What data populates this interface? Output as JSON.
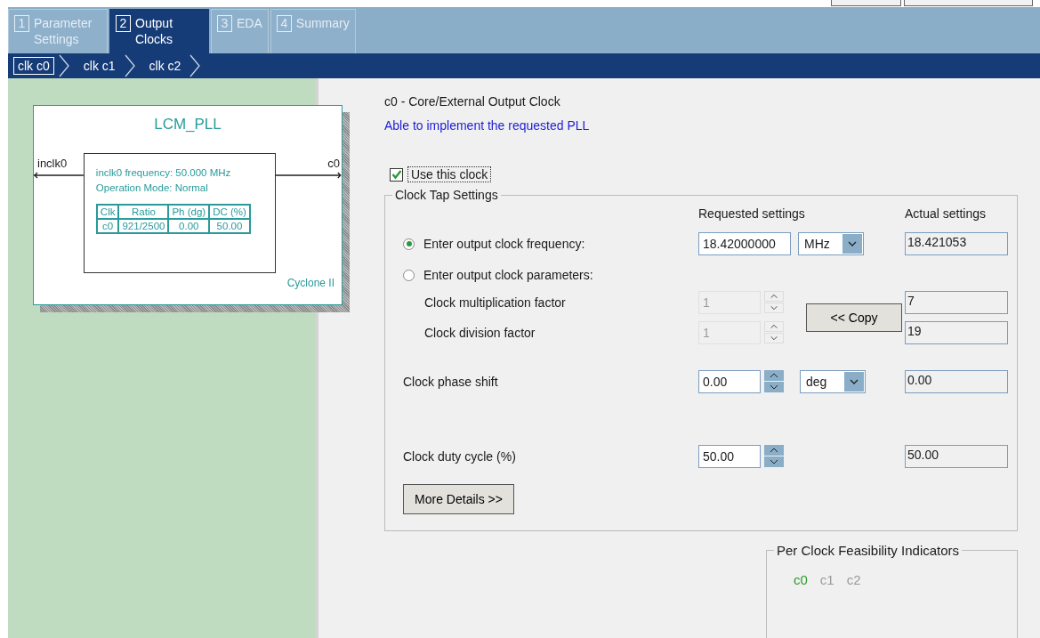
{
  "tabs": [
    {
      "number": "1",
      "label": "Parameter Settings",
      "selected": false
    },
    {
      "number": "2",
      "label": "Output Clocks",
      "selected": true
    },
    {
      "number": "3",
      "label": "EDA",
      "selected": false
    },
    {
      "number": "4",
      "label": "Summary",
      "selected": false
    }
  ],
  "clock_steps": [
    {
      "label": "clk c0",
      "selected": true
    },
    {
      "label": "clk c1",
      "selected": false
    },
    {
      "label": "clk c2",
      "selected": false
    }
  ],
  "diagram": {
    "title": "LCM_PLL",
    "input": "inclk0",
    "output": "c0",
    "info": [
      "inclk0 frequency: 50.000 MHz",
      "Operation Mode: Normal"
    ],
    "table": {
      "columns": [
        "Clk",
        "Ratio",
        "Ph (dg)",
        "DC (%)"
      ],
      "rows": [
        [
          "c0",
          "921/2500",
          "0.00",
          "50.00"
        ]
      ]
    },
    "device": "Cyclone II"
  },
  "heading": "c0 - Core/External Output Clock",
  "status": "Able to implement the requested PLL",
  "use_clock": {
    "label": "Use this clock",
    "checked": true
  },
  "clock_tap": {
    "title": "Clock Tap Settings",
    "requested_header": "Requested settings",
    "actual_header": "Actual settings",
    "rows": [
      {
        "kind": "radio",
        "label": "Enter output clock frequency:",
        "selected": true,
        "value": "18.42000000",
        "unit": "MHz",
        "actual": "18.421053"
      },
      {
        "kind": "radio",
        "label": "Enter output clock parameters:",
        "selected": false
      },
      {
        "kind": "factor",
        "label": "Clock multiplication factor",
        "value": "1",
        "disabled": true,
        "actual": "7"
      },
      {
        "kind": "factor",
        "label": "Clock division factor",
        "value": "1",
        "disabled": true,
        "actual": "19"
      },
      {
        "kind": "spin",
        "label": "Clock phase shift",
        "value": "0.00",
        "unit": "deg",
        "actual": "0.00"
      },
      {
        "kind": "spin",
        "label": "Clock duty cycle (%)",
        "value": "50.00",
        "actual": "50.00"
      }
    ],
    "copy_button": "<< Copy",
    "details_button": "More Details >>"
  },
  "feasibility": {
    "title": "Per Clock Feasibility Indicators",
    "clocks": [
      {
        "label": "c0",
        "color": "#2e9a2e"
      },
      {
        "label": "c1",
        "color": "#9a9a9a"
      },
      {
        "label": "c2",
        "color": "#9a9a9a"
      }
    ]
  }
}
